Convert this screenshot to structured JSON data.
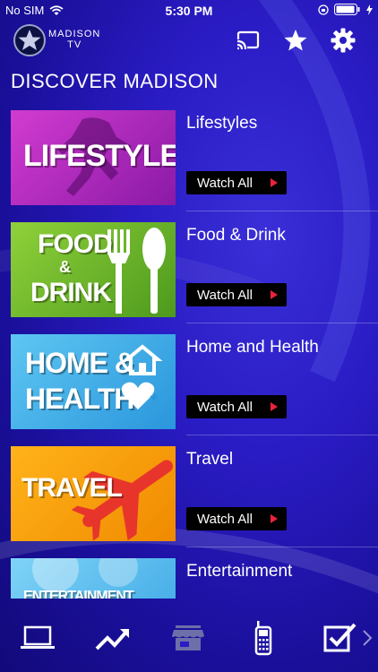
{
  "status_bar": {
    "carrier": "No SIM",
    "time": "5:30 PM"
  },
  "header": {
    "logo_line1": "MADISON",
    "logo_line2": "TV"
  },
  "page_title": "DISCOVER MADISON",
  "watch_label": "Watch All",
  "categories": [
    {
      "title": "Lifestyles",
      "thumb_text": "LIFESTYLES"
    },
    {
      "title": "Food & Drink",
      "thumb_line1": "FOOD",
      "thumb_line2": "&",
      "thumb_line3": "DRINK"
    },
    {
      "title": "Home and Health",
      "thumb_line1": "HOME &",
      "thumb_line2": "HEALTH"
    },
    {
      "title": "Travel",
      "thumb_text": "TRAVEL"
    },
    {
      "title": "Entertainment",
      "thumb_text": "ENTERTAINMENT"
    }
  ],
  "icons": {
    "wifi": "wifi-icon",
    "battery": "battery-icon",
    "cast": "cast-icon",
    "favorites": "star-icon",
    "settings": "gear-icon",
    "tabs": [
      "laptop-icon",
      "trending-icon",
      "store-icon",
      "phone-icon",
      "checkbox-icon",
      "chevron-right-icon"
    ]
  }
}
